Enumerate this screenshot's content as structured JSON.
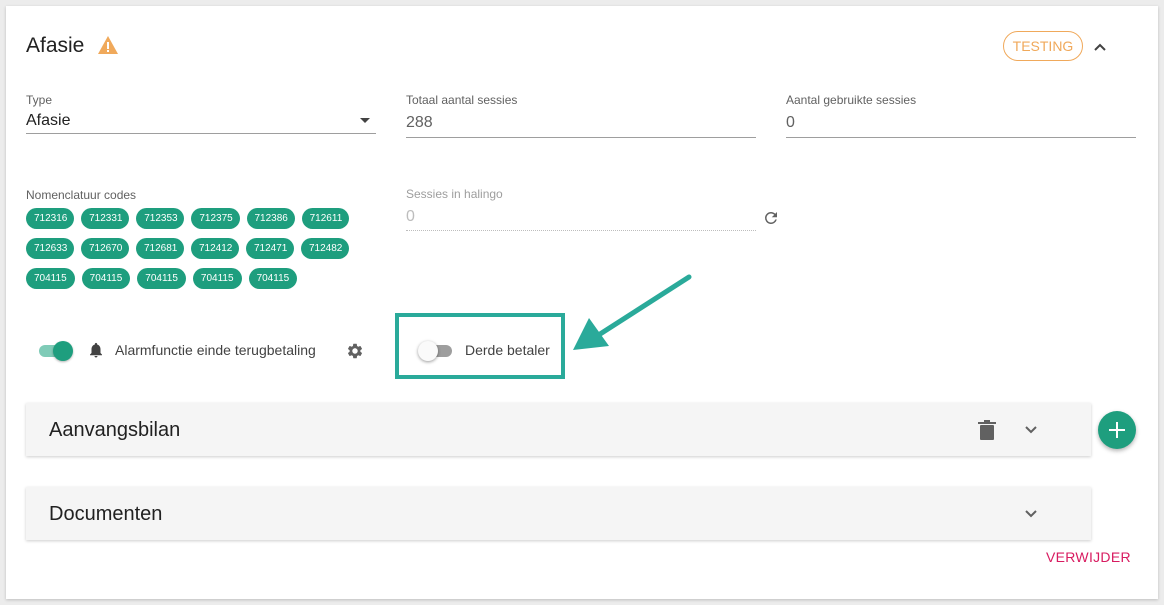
{
  "header": {
    "title": "Afasie",
    "status_badge": "TESTING",
    "accent_color": "#1e9e7e",
    "warning_color": "#f0a95b"
  },
  "fields": {
    "type": {
      "label": "Type",
      "value": "Afasie"
    },
    "total_sessions": {
      "label": "Totaal aantal sessies",
      "value": "288"
    },
    "used_sessions": {
      "label": "Aantal gebruikte sessies",
      "value": "0"
    },
    "nomenclature": {
      "label": "Nomenclatuur codes",
      "rows": [
        [
          "712316",
          "712331",
          "712353",
          "712375",
          "712386",
          "712611"
        ],
        [
          "712633",
          "712670",
          "712681",
          "712412",
          "712471",
          "712482"
        ],
        [
          "704115",
          "704115",
          "704115",
          "704115",
          "704115"
        ]
      ]
    },
    "halingo_sessions": {
      "label": "Sessies in halingo",
      "value": "0"
    }
  },
  "toggles": {
    "alarm": {
      "label": "Alarmfunctie einde terugbetaling",
      "on": true
    },
    "derde_betaler": {
      "label": "Derde betaler",
      "on": false
    }
  },
  "panels": {
    "aanvangsbilan": {
      "title": "Aanvangsbilan"
    },
    "documenten": {
      "title": "Documenten"
    }
  },
  "actions": {
    "delete_label": "VERWIJDER"
  }
}
